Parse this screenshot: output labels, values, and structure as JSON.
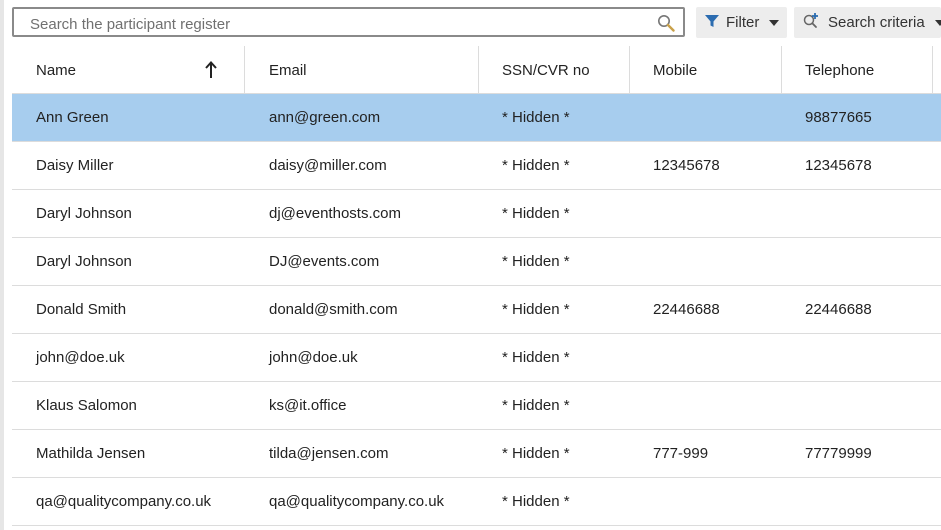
{
  "search": {
    "placeholder": "Search the participant register"
  },
  "toolbar": {
    "filter_label": "Filter",
    "criteria_label": "Search criteria"
  },
  "columns": [
    "Name",
    "Email",
    "SSN/CVR no",
    "Mobile",
    "Telephone"
  ],
  "sort": {
    "column": "Name",
    "direction": "ascending"
  },
  "rows": [
    {
      "name": "Ann Green",
      "email": "ann@green.com",
      "ssn": "* Hidden *",
      "mobile": "",
      "telephone": "98877665",
      "selected": true
    },
    {
      "name": "Daisy Miller",
      "email": "daisy@miller.com",
      "ssn": "* Hidden *",
      "mobile": "12345678",
      "telephone": "12345678",
      "selected": false
    },
    {
      "name": "Daryl Johnson",
      "email": "dj@eventhosts.com",
      "ssn": "* Hidden *",
      "mobile": "",
      "telephone": "",
      "selected": false
    },
    {
      "name": "Daryl Johnson",
      "email": "DJ@events.com",
      "ssn": "* Hidden *",
      "mobile": "",
      "telephone": "",
      "selected": false
    },
    {
      "name": "Donald Smith",
      "email": "donald@smith.com",
      "ssn": "* Hidden *",
      "mobile": "22446688",
      "telephone": "22446688",
      "selected": false
    },
    {
      "name": "john@doe.uk",
      "email": "john@doe.uk",
      "ssn": "* Hidden *",
      "mobile": "",
      "telephone": "",
      "selected": false
    },
    {
      "name": "Klaus Salomon",
      "email": "ks@it.office",
      "ssn": "* Hidden *",
      "mobile": "",
      "telephone": "",
      "selected": false
    },
    {
      "name": "Mathilda Jensen",
      "email": "tilda@jensen.com",
      "ssn": "* Hidden *",
      "mobile": "777-999",
      "telephone": "77779999",
      "selected": false
    },
    {
      "name": "qa@qualitycompany.co.uk",
      "email": "qa@qualitycompany.co.uk",
      "ssn": "* Hidden *",
      "mobile": "",
      "telephone": "",
      "selected": false
    }
  ],
  "colors": {
    "selected_row": "#a7cdee",
    "filter_icon": "#2b6cb0",
    "button_bg": "#ededed"
  },
  "icons": {
    "search": "search-icon",
    "filter": "filter-icon",
    "criteria": "search-plus-icon",
    "sort": "arrow-up-icon"
  }
}
